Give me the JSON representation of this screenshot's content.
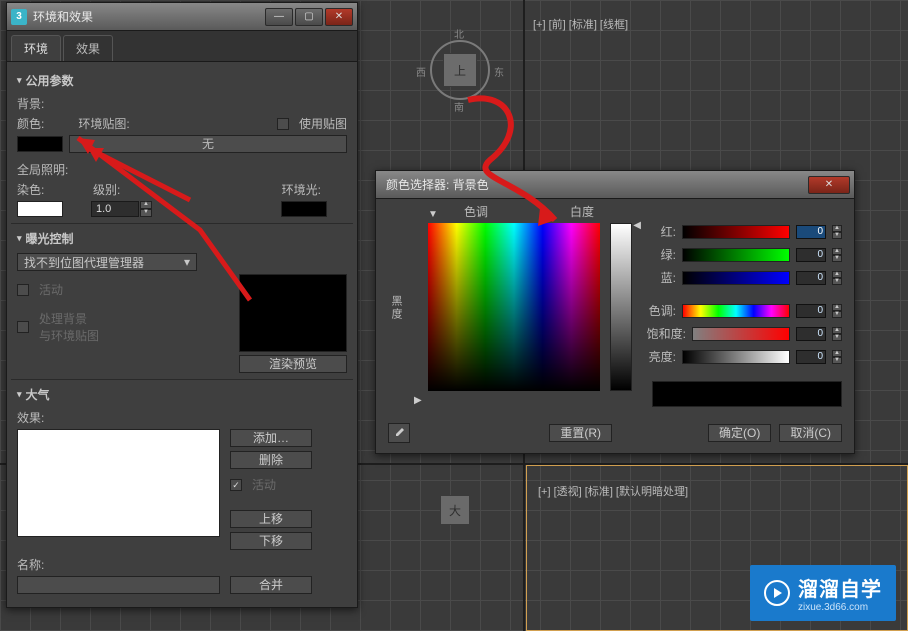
{
  "viewport": {
    "top_label": "[+] [前] [标准] [线框]",
    "bottom_label": "[+] [透视] [标准] [默认明暗处理]",
    "compass": {
      "n": "北",
      "s": "南",
      "e": "东",
      "w": "西",
      "face": "上"
    },
    "cube_face": "大"
  },
  "env_dialog": {
    "title": "环境和效果",
    "tabs": {
      "env": "环境",
      "effects": "效果"
    },
    "common": {
      "header": "公用参数",
      "background": "背景:",
      "color": "颜色:",
      "env_map": "环境贴图:",
      "use_map": "使用贴图",
      "none": "无",
      "global_light": "全局照明:",
      "tint": "染色:",
      "level": "级别:",
      "level_val": "1.0",
      "ambient": "环境光:"
    },
    "exposure": {
      "header": "曝光控制",
      "selector": "找不到位图代理管理器",
      "active": "活动",
      "process": "处理背景\n与环境贴图",
      "render_preview": "渲染预览"
    },
    "atmos": {
      "header": "大气",
      "effects": "效果:",
      "add": "添加…",
      "delete": "删除",
      "active": "活动",
      "move_up": "上移",
      "move_down": "下移",
      "merge": "合并",
      "name": "名称:"
    }
  },
  "picker": {
    "title": "颜色选择器: 背景色",
    "hue_label": "色调",
    "whiteness_label": "白度",
    "blackness_label": "黑度",
    "sliders": {
      "red": {
        "label": "红:",
        "value": "0"
      },
      "green": {
        "label": "绿:",
        "value": "0"
      },
      "blue": {
        "label": "蓝:",
        "value": "0"
      },
      "hue": {
        "label": "色调:",
        "value": "0"
      },
      "sat": {
        "label": "饱和度:",
        "value": "0"
      },
      "val": {
        "label": "亮度:",
        "value": "0"
      }
    },
    "eyedropper": "eyedropper",
    "reset": "重置(R)",
    "ok": "确定(O)",
    "cancel": "取消(C)"
  },
  "watermark": {
    "brand": "溜溜自学",
    "sub": "zixue.3d66.com"
  }
}
